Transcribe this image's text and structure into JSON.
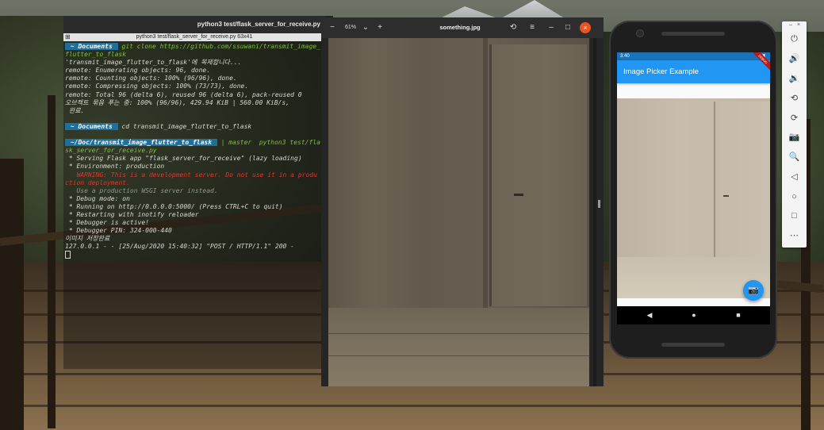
{
  "terminal": {
    "title": "python3 test/flask_server_for_receive.py",
    "tab_label": "python3 test/flask_server_for_receive.py 63x41",
    "prompt_dir_1": " ~ Documents ",
    "cmd_1": " git clone https://github.com/ssuwani/transmit_image_flutter_to_flask",
    "lines_1": [
      "'transmit_image_flutter_to_flask'에 복제합니다...",
      "remote: Enumerating objects: 96, done.",
      "remote: Counting objects: 100% (96/96), done.",
      "remote: Compressing objects: 100% (73/73), done.",
      "remote: Total 96 (delta 6), reused 96 (delta 6), pack-reused 0",
      "오브젝트 묶음 푸는 중: 100% (96/96), 429.94 KiB | 560.00 KiB/s,",
      " 완료."
    ],
    "prompt_dir_2": " ~ Documents ",
    "cmd_2": "cd transmit_image_flutter_to_flask",
    "prompt_dir_3": " ~/Doc/transmit_image_flutter_to_flask ",
    "git_branch": " | master ",
    "cmd_3": " python3 test/flask_server_for_receive.py",
    "server_lines": [
      " * Serving Flask app \"flask_server_for_receive\" (lazy loading)",
      " * Environment: production"
    ],
    "warning_lines": [
      "   WARNING: This is a development server. Do not use it in a production deployment."
    ],
    "muted_line": "   Use a production WSGI server instead.",
    "server_lines_2": [
      " * Debug mode: on",
      " * Running on http://0.0.0.0:5000/ (Press CTRL+C to quit)",
      " * Restarting with inotify reloader",
      " * Debugger is active!",
      " * Debugger PIN: 324-000-440"
    ],
    "saved_msg": "이미지 저장완료",
    "request_log": "127.0.0.1 - - [25/Aug/2020 15:40:32] \"POST / HTTP/1.1\" 200 -"
  },
  "viewer": {
    "zoom_out_icon": "−",
    "zoom_level": "61%",
    "zoom_menu_icon": "⌄",
    "zoom_in_icon": "+",
    "filename": "something.jpg",
    "rotate_icon": "⟲",
    "menu_icon": "≡",
    "minimize_icon": "–",
    "maximize_icon": "□",
    "close_icon": "×"
  },
  "phone": {
    "time": "3:40",
    "status_icons": "▾◢▮",
    "debug_label": "DEBUG",
    "app_title": "Image Picker Example",
    "fab_icon": "📷",
    "nav_back": "◀",
    "nav_home": "●",
    "nav_recent": "■"
  },
  "emulator_toolbar": {
    "min_icon": "–",
    "close_icon": "×",
    "buttons": [
      "⏻",
      "🔊",
      "🔉",
      "⟲",
      "⟳",
      "📷",
      "🔍",
      "◁",
      "○",
      "□",
      "⋯"
    ]
  }
}
